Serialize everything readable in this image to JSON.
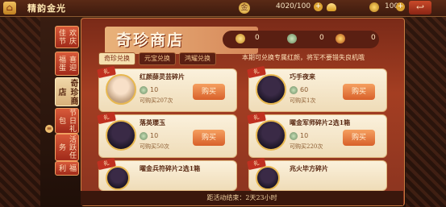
{
  "topbar": {
    "title": "精韵金光",
    "gold_mark": "金",
    "currency1": "4020/100",
    "currency2": "100",
    "back_icon": "back-arrow-icon",
    "home_icon": "home-icon"
  },
  "tabs": [
    {
      "label": "欢庆佳节",
      "active": false
    },
    {
      "label": "喜迎福蛋",
      "active": false
    },
    {
      "label": "奇珍商店",
      "active": true
    },
    {
      "label": "节日礼包",
      "active": false
    },
    {
      "label": "活跃任务",
      "active": false
    },
    {
      "label": "福利",
      "active": false
    }
  ],
  "shop": {
    "header": "奇珍商店",
    "counts": [
      "0",
      "0",
      "0"
    ],
    "filters": [
      {
        "label": "奇珍兑换",
        "active": true
      },
      {
        "label": "元宝兑换",
        "active": false
      },
      {
        "label": "鸿耀兑换",
        "active": false
      }
    ],
    "notice": "本期可兑换专属红颜，将军不要错失良机哦",
    "items": [
      {
        "tag": "礼",
        "name": "红颜薛灵芸碎片",
        "cost": "10",
        "limit": "可购买207次",
        "buy": "购买"
      },
      {
        "tag": "礼",
        "name": "巧手夜来",
        "cost": "60",
        "limit": "可购买1次",
        "buy": "购买"
      },
      {
        "tag": "礼",
        "name": "落英璎玉",
        "cost": "10",
        "limit": "可购买50次",
        "buy": "购买"
      },
      {
        "tag": "礼",
        "name": "曜金军师碎片2选1箱",
        "cost": "10",
        "limit": "可购买220次",
        "buy": "购买"
      },
      {
        "tag": "礼",
        "name": "曜金兵符碎片2选1箱",
        "cost": "",
        "limit": "",
        "buy": ""
      },
      {
        "tag": "礼",
        "name": "兆火毕方碎片",
        "cost": "",
        "limit": "",
        "buy": ""
      }
    ]
  },
  "bottom_text": "距活动结束：2天23小时"
}
